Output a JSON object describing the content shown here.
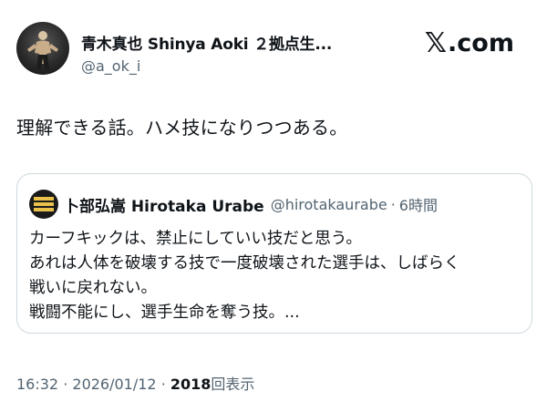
{
  "author": {
    "display_name": "青木真也 Shinya Aoki ２拠点生...",
    "handle": "@a_ok_i"
  },
  "brand": {
    "logo_text": ".com",
    "logo_icon": "x-logo-icon"
  },
  "tweet": {
    "text": "理解できる話。ハメ技になりつつある。"
  },
  "quoted_tweet": {
    "display_name": "卜部弘嵩 Hirotaka Urabe",
    "handle": "@hirotakaurabe",
    "separator": "·",
    "time": "6時間",
    "lines": [
      "カーフキックは、禁止にしていい技だと思う。",
      "あれは人体を破壊する技で一度破壊された選手は、しばらく",
      "戦いに戻れない。",
      "戦闘不能にし、選手生命を奪う技。..."
    ]
  },
  "meta": {
    "time": "16:32",
    "sep1": "·",
    "date": "2026/01/12",
    "sep2": "·",
    "views_count": "2018",
    "views_label": "回表示"
  },
  "colors": {
    "text_primary": "#0f1419",
    "text_secondary": "#536471",
    "border": "#cfd9de"
  }
}
